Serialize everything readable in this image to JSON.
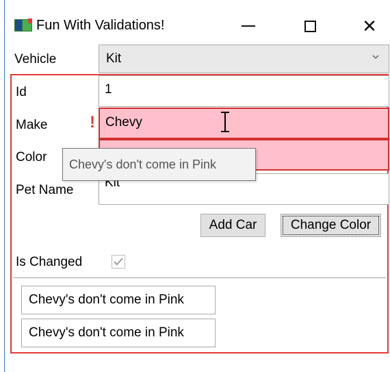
{
  "window": {
    "title": "Fun With Validations!",
    "accent_color": "#3a78c7",
    "error_color": "#e53935",
    "error_fill": "#ffc0cb",
    "minimize_icon": "minimize-icon",
    "maximize_icon": "maximize-icon",
    "close_icon": "close-icon",
    "close_glyph": "✕"
  },
  "vehicle": {
    "label": "Vehicle",
    "selected": "Kit",
    "icon": "chevron-down-icon"
  },
  "form": {
    "id_label": "Id",
    "id_value": "1",
    "make_label": "Make",
    "make_value": "Chevy",
    "make_error_mark": "!",
    "color_label": "Color",
    "color_value": "Pink",
    "pet_name_label": "Pet Name",
    "pet_name_value": "Kit",
    "tooltip": "Chevy's don't come in Pink",
    "add_car_label": "Add Car",
    "change_color_label": "Change Color",
    "is_changed_label": "Is Changed",
    "is_changed_checked": true
  },
  "errors": {
    "items": [
      "Chevy's don't come in Pink",
      "Chevy's don't come in Pink"
    ]
  }
}
